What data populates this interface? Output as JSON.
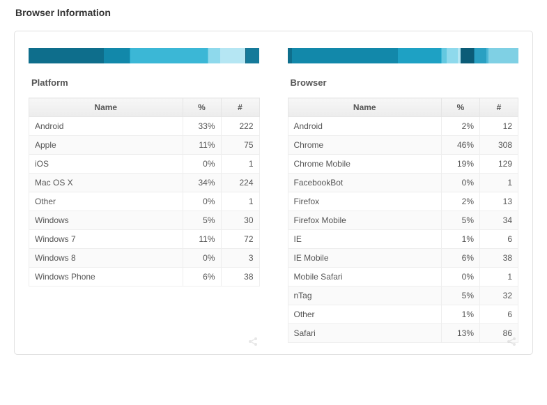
{
  "page_title": "Browser Information",
  "platform": {
    "title": "Platform",
    "headers": {
      "name": "Name",
      "pct": "%",
      "count": "#"
    },
    "rows": [
      {
        "name": "Android",
        "pct": "33%",
        "count": "222"
      },
      {
        "name": "Apple",
        "pct": "11%",
        "count": "75"
      },
      {
        "name": "iOS",
        "pct": "0%",
        "count": "1"
      },
      {
        "name": "Mac OS X",
        "pct": "34%",
        "count": "224"
      },
      {
        "name": "Other",
        "pct": "0%",
        "count": "1"
      },
      {
        "name": "Windows",
        "pct": "5%",
        "count": "30"
      },
      {
        "name": "Windows 7",
        "pct": "11%",
        "count": "72"
      },
      {
        "name": "Windows 8",
        "pct": "0%",
        "count": "3"
      },
      {
        "name": "Windows Phone",
        "pct": "6%",
        "count": "38"
      }
    ]
  },
  "browser": {
    "title": "Browser",
    "headers": {
      "name": "Name",
      "pct": "%",
      "count": "#"
    },
    "rows": [
      {
        "name": "Android",
        "pct": "2%",
        "count": "12"
      },
      {
        "name": "Chrome",
        "pct": "46%",
        "count": "308"
      },
      {
        "name": "Chrome Mobile",
        "pct": "19%",
        "count": "129"
      },
      {
        "name": "FacebookBot",
        "pct": "0%",
        "count": "1"
      },
      {
        "name": "Firefox",
        "pct": "2%",
        "count": "13"
      },
      {
        "name": "Firefox Mobile",
        "pct": "5%",
        "count": "34"
      },
      {
        "name": "IE",
        "pct": "1%",
        "count": "6"
      },
      {
        "name": "IE Mobile",
        "pct": "6%",
        "count": "38"
      },
      {
        "name": "Mobile Safari",
        "pct": "0%",
        "count": "1"
      },
      {
        "name": "nTag",
        "pct": "5%",
        "count": "32"
      },
      {
        "name": "Other",
        "pct": "1%",
        "count": "6"
      },
      {
        "name": "Safari",
        "pct": "13%",
        "count": "86"
      }
    ]
  },
  "palette": [
    "#0e6e8c",
    "#1288aa",
    "#1ea1c4",
    "#3bb7d6",
    "#63c8e0",
    "#8ed9ec",
    "#b5e6f3",
    "#0b5c77",
    "#157a9a",
    "#2aa0c2",
    "#4db8d6",
    "#7fd0e4"
  ],
  "chart_data": [
    {
      "type": "bar",
      "orientation": "stacked-horizontal",
      "title": "Platform",
      "categories": [
        "Android",
        "Apple",
        "iOS",
        "Mac OS X",
        "Other",
        "Windows",
        "Windows 7",
        "Windows 8",
        "Windows Phone"
      ],
      "values": [
        33,
        11,
        0,
        34,
        0,
        5,
        11,
        0,
        6
      ],
      "counts": [
        222,
        75,
        1,
        224,
        1,
        30,
        72,
        3,
        38
      ],
      "xlabel": "",
      "ylabel": "%",
      "ylim": [
        0,
        100
      ]
    },
    {
      "type": "bar",
      "orientation": "stacked-horizontal",
      "title": "Browser",
      "categories": [
        "Android",
        "Chrome",
        "Chrome Mobile",
        "FacebookBot",
        "Firefox",
        "Firefox Mobile",
        "IE",
        "IE Mobile",
        "Mobile Safari",
        "nTag",
        "Other",
        "Safari"
      ],
      "values": [
        2,
        46,
        19,
        0,
        2,
        5,
        1,
        6,
        0,
        5,
        1,
        13
      ],
      "counts": [
        12,
        308,
        129,
        1,
        13,
        34,
        6,
        38,
        1,
        32,
        6,
        86
      ],
      "xlabel": "",
      "ylabel": "%",
      "ylim": [
        0,
        100
      ]
    }
  ]
}
